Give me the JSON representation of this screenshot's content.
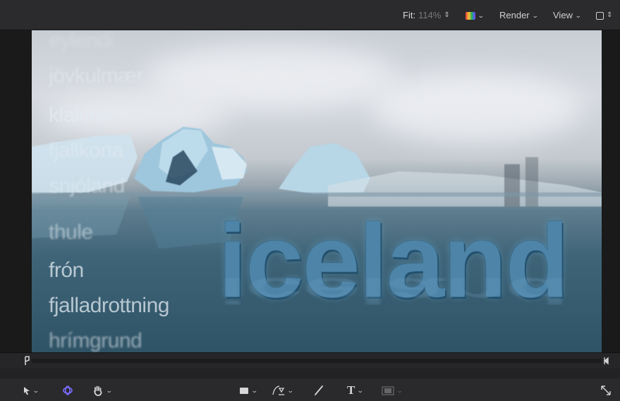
{
  "topbar": {
    "fit_label": "Fit:",
    "fit_value": "114%",
    "render_label": "Render",
    "view_label": "View"
  },
  "viewer": {
    "title": "iceland",
    "words": [
      "eylendi",
      "jövkulmær",
      "klakinn",
      "fjallkona",
      "snjóland",
      "thule",
      "frón",
      "fjalladrottning",
      "hrímgrund"
    ]
  },
  "toolbar": {
    "text_tool_label": "T"
  },
  "colors": {
    "accent_purple": "#7a6cff",
    "title_blue": "#4d84a8"
  }
}
